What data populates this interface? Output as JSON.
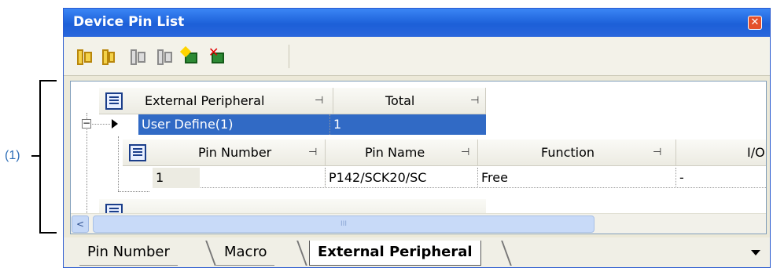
{
  "annotation": {
    "label": "(1)"
  },
  "window": {
    "title": "Device Pin List",
    "close_icon": "close-icon"
  },
  "toolbar": {
    "buttons": [
      "expand-all-icon",
      "collapse-all-icon",
      "expand-all-disabled-icon",
      "collapse-all-disabled-icon",
      "add-chip-icon",
      "remove-chip-icon"
    ]
  },
  "group_table": {
    "columns": [
      "External Peripheral",
      "Total"
    ],
    "rows": [
      {
        "external_peripheral": "User Define(1)",
        "total": "1",
        "selected": true
      }
    ]
  },
  "pin_table": {
    "columns": [
      "Pin Number",
      "Pin Name",
      "Function",
      "I/O"
    ],
    "rows": [
      {
        "pin_number": "1",
        "pin_name": "P142/SCK20/SC",
        "function": "Free",
        "io": "-"
      }
    ]
  },
  "scrollbar": {
    "left_arrow": "<",
    "grip": "III"
  },
  "tabs": [
    {
      "label": "Pin Number",
      "active": false
    },
    {
      "label": "Macro",
      "active": false
    },
    {
      "label": "External Peripheral",
      "active": true
    }
  ]
}
